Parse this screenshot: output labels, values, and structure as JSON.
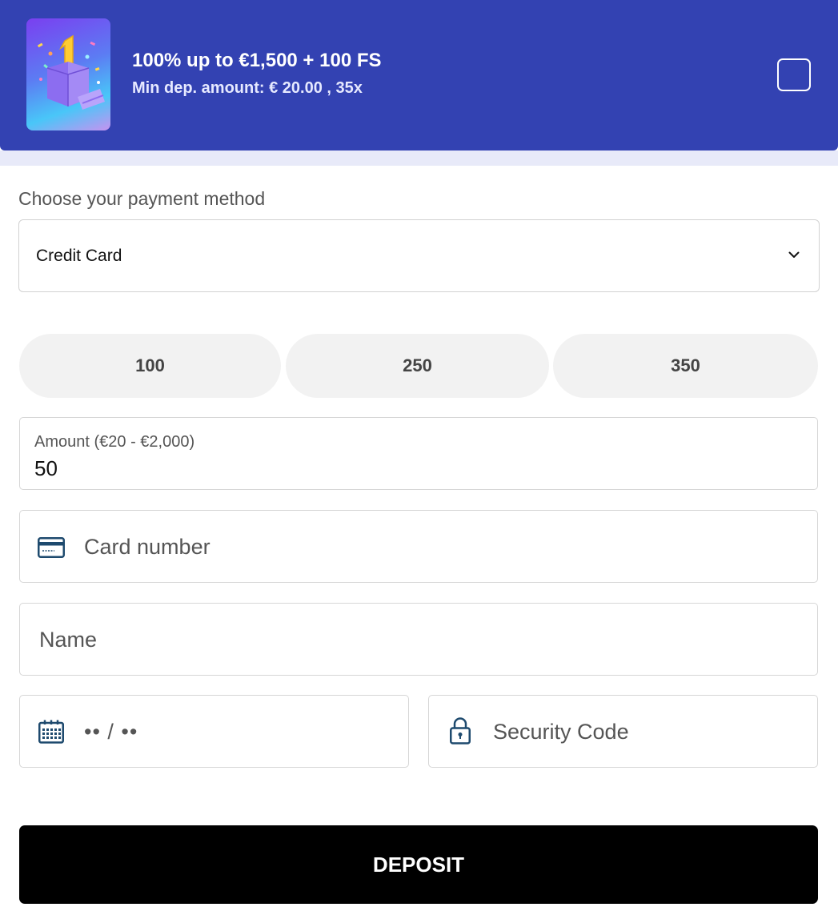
{
  "bonus": {
    "title": "100% up to €1,500 + 100 FS",
    "subtitle": "Min dep. amount: € 20.00 , 35x",
    "thumbnail_icon": "gift-box-icon",
    "checkbox_checked": false,
    "colors": {
      "banner": "#3342b2",
      "strip": "#e8eaf9"
    }
  },
  "payment": {
    "label": "Choose your payment method",
    "selected": "Credit Card",
    "dropdown_icon": "chevron-down-icon"
  },
  "presets": [
    "100",
    "250",
    "350"
  ],
  "amount": {
    "label": "Amount (€20 - €2,000)",
    "value": "50"
  },
  "card_number": {
    "placeholder": "Card number",
    "icon": "credit-card-icon"
  },
  "name": {
    "placeholder": "Name"
  },
  "expiry": {
    "placeholder": "•• / ••",
    "icon": "calendar-icon"
  },
  "security_code": {
    "placeholder": "Security Code",
    "icon": "lock-icon"
  },
  "deposit": {
    "label": "DEPOSIT",
    "color": "#000000"
  }
}
